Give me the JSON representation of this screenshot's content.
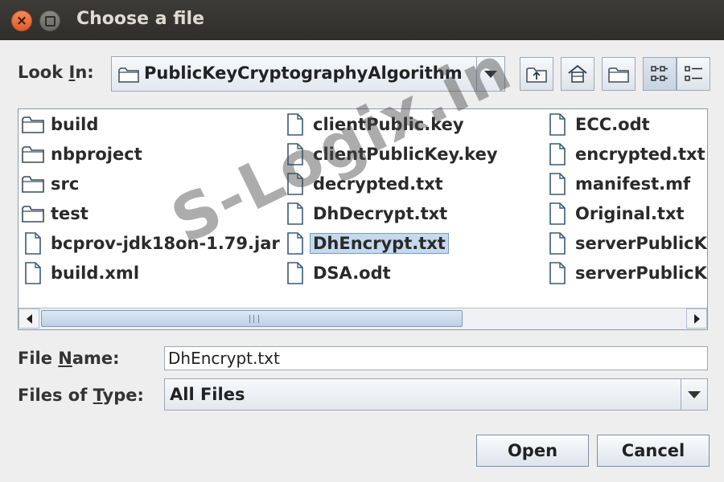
{
  "window": {
    "title": "Choose a file"
  },
  "look_in": {
    "label_pre": "Look ",
    "label_key": "I",
    "label_post": "n:",
    "value": "PublicKeyCryptographyAlgorithm"
  },
  "files": {
    "col1": [
      "build",
      "nbproject",
      "src",
      "test",
      "bcprov-jdk18on-1.79.jar",
      "build.xml"
    ],
    "col2": [
      "clientPublic.key",
      "clientPublicKey.key",
      "decrypted.txt",
      "DhDecrypt.txt",
      "DhEncrypt.txt",
      "DSA.odt"
    ],
    "col3": [
      "ECC.odt",
      "encrypted.txt",
      "manifest.mf",
      "Original.txt",
      "serverPublicK",
      "serverPublicK"
    ]
  },
  "file_name": {
    "label_pre": "File ",
    "label_key": "N",
    "label_post": "ame:",
    "value": "DhEncrypt.txt"
  },
  "file_type": {
    "label_pre": "Files of ",
    "label_key": "T",
    "label_post": "ype:",
    "value": "All Files"
  },
  "buttons": {
    "open": "Open",
    "cancel": "Cancel"
  },
  "watermark": "S-Logix.in",
  "colors": {
    "titlebar": "#3c3b37",
    "selection": "#c5d9ee",
    "close_button": "#e8673a"
  }
}
